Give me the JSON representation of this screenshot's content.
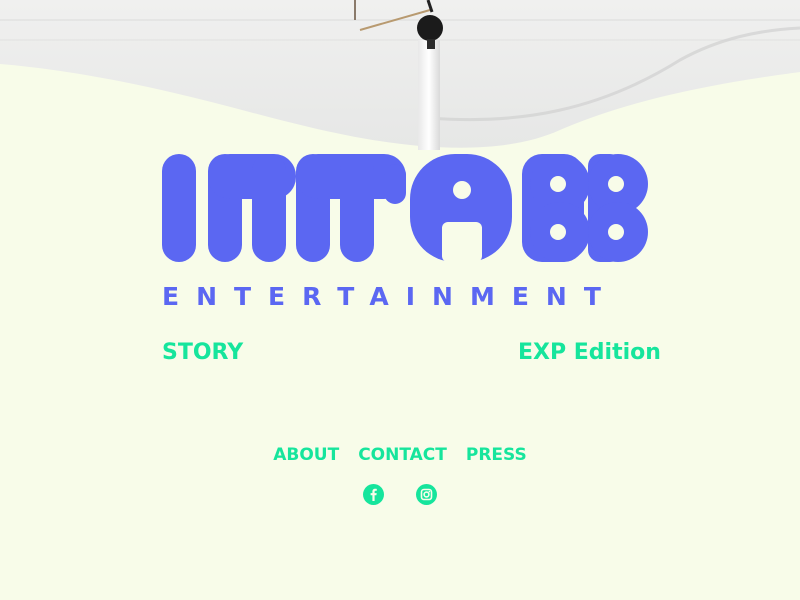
{
  "logo": {
    "wordmark": "IMMABB",
    "subtitle": "ENTERTAINMENT"
  },
  "links": {
    "story": "STORY",
    "exp_edition": "EXP Edition"
  },
  "footer_nav": [
    "ABOUT",
    "CONTACT",
    "PRESS"
  ],
  "social": [
    "facebook-icon",
    "instagram-icon"
  ],
  "colors": {
    "background": "#f8fce9",
    "logo_blue": "#5b67f2",
    "link_green": "#16e59c"
  }
}
